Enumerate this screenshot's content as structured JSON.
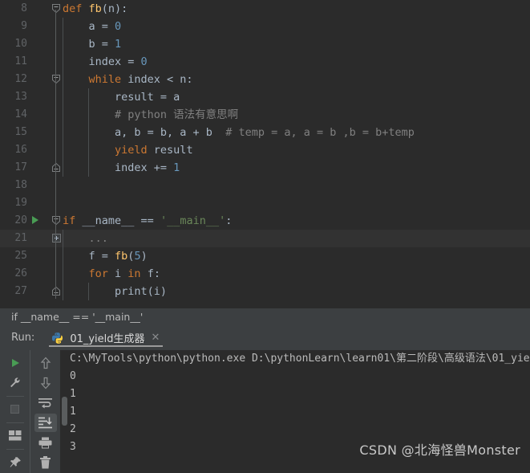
{
  "editor": {
    "lines": [
      {
        "num": "8",
        "indent": 0,
        "fold": "open",
        "run": false,
        "tokens": [
          {
            "t": "def ",
            "c": "kw"
          },
          {
            "t": "fb",
            "c": "fn"
          },
          {
            "t": "(n):",
            "c": "def"
          }
        ]
      },
      {
        "num": "9",
        "indent": 1,
        "fold": "none",
        "run": false,
        "tokens": [
          {
            "t": "    a = ",
            "c": "def"
          },
          {
            "t": "0",
            "c": "num"
          }
        ]
      },
      {
        "num": "10",
        "indent": 1,
        "fold": "none",
        "run": false,
        "tokens": [
          {
            "t": "    b = ",
            "c": "def"
          },
          {
            "t": "1",
            "c": "num"
          }
        ]
      },
      {
        "num": "11",
        "indent": 1,
        "fold": "none",
        "run": false,
        "tokens": [
          {
            "t": "    index = ",
            "c": "def"
          },
          {
            "t": "0",
            "c": "num"
          }
        ]
      },
      {
        "num": "12",
        "indent": 1,
        "fold": "open2",
        "run": false,
        "tokens": [
          {
            "t": "    ",
            "c": "def"
          },
          {
            "t": "while",
            "c": "kw"
          },
          {
            "t": " index < n:",
            "c": "def"
          }
        ]
      },
      {
        "num": "13",
        "indent": 2,
        "fold": "none",
        "run": false,
        "tokens": [
          {
            "t": "        result = a",
            "c": "def"
          }
        ]
      },
      {
        "num": "14",
        "indent": 2,
        "fold": "none",
        "run": false,
        "tokens": [
          {
            "t": "        # python 语法有意思啊",
            "c": "com"
          }
        ]
      },
      {
        "num": "15",
        "indent": 2,
        "fold": "none",
        "run": false,
        "tokens": [
          {
            "t": "        a, b = b, a + b  ",
            "c": "def"
          },
          {
            "t": "# temp = a, a = b ,b = b+temp",
            "c": "com"
          }
        ]
      },
      {
        "num": "16",
        "indent": 2,
        "fold": "none",
        "run": false,
        "tokens": [
          {
            "t": "        ",
            "c": "def"
          },
          {
            "t": "yield",
            "c": "kw"
          },
          {
            "t": " result",
            "c": "def"
          }
        ]
      },
      {
        "num": "17",
        "indent": 2,
        "fold": "close2",
        "run": false,
        "tokens": [
          {
            "t": "        index += ",
            "c": "def"
          },
          {
            "t": "1",
            "c": "num"
          }
        ]
      },
      {
        "num": "18",
        "indent": 0,
        "fold": "none",
        "run": false,
        "tokens": []
      },
      {
        "num": "19",
        "indent": 0,
        "fold": "none",
        "run": false,
        "tokens": []
      },
      {
        "num": "20",
        "indent": 0,
        "fold": "open",
        "run": true,
        "tokens": [
          {
            "t": "if",
            "c": "kw"
          },
          {
            "t": " __name__ == ",
            "c": "def"
          },
          {
            "t": "'__main__'",
            "c": "str"
          },
          {
            "t": ":",
            "c": "def"
          }
        ]
      },
      {
        "num": "21",
        "indent": 1,
        "fold": "plus",
        "run": false,
        "folded": true,
        "tokens": [
          {
            "t": "    ...",
            "c": "ph"
          }
        ]
      },
      {
        "num": "25",
        "indent": 1,
        "fold": "none",
        "run": false,
        "tokens": [
          {
            "t": "    f = ",
            "c": "def"
          },
          {
            "t": "fb",
            "c": "fn"
          },
          {
            "t": "(",
            "c": "def"
          },
          {
            "t": "5",
            "c": "num"
          },
          {
            "t": ")",
            "c": "def"
          }
        ]
      },
      {
        "num": "26",
        "indent": 1,
        "fold": "none",
        "run": false,
        "tokens": [
          {
            "t": "    ",
            "c": "def"
          },
          {
            "t": "for",
            "c": "kw"
          },
          {
            "t": " i ",
            "c": "def"
          },
          {
            "t": "in",
            "c": "kw"
          },
          {
            "t": " f:",
            "c": "def"
          }
        ]
      },
      {
        "num": "27",
        "indent": 2,
        "fold": "close2",
        "run": false,
        "tokens": [
          {
            "t": "        ",
            "c": "def"
          },
          {
            "t": "print",
            "c": "def"
          },
          {
            "t": "(i)",
            "c": "def"
          }
        ]
      }
    ]
  },
  "breadcrumb": {
    "text": "if __name__ == '__main__'"
  },
  "run_panel": {
    "label": "Run:",
    "tab_name": "01_yield生成器",
    "tab_close": "✕",
    "toolbar_left": [
      {
        "name": "rerun-button",
        "icon": "play-icon"
      },
      {
        "name": "debug-button",
        "icon": "wrench-icon"
      },
      {
        "name": "stop-button",
        "icon": "stop-icon"
      },
      {
        "name": "layout-button",
        "icon": "layout-icon"
      },
      {
        "name": "pin-button",
        "icon": "pin-icon"
      }
    ],
    "toolbar_right": [
      {
        "name": "up-button",
        "icon": "arrow-up-icon"
      },
      {
        "name": "down-button",
        "icon": "arrow-down-icon"
      },
      {
        "name": "soft-wrap-button",
        "icon": "soft-wrap-icon"
      },
      {
        "name": "scroll-end-button",
        "icon": "scroll-to-end-icon",
        "active": true
      },
      {
        "name": "print-button",
        "icon": "printer-icon"
      },
      {
        "name": "clear-all-button",
        "icon": "trash-icon"
      }
    ],
    "console": {
      "command": "C:\\MyTools\\python\\python.exe D:\\pythonLearn\\learn01\\第二阶段\\高级语法\\01_yie",
      "output": [
        "0",
        "1",
        "1",
        "2",
        "3"
      ]
    }
  },
  "watermark": {
    "text": "CSDN @北海怪兽Monster"
  },
  "colors": {
    "editor_bg": "#2b2b2b",
    "panel_bg": "#3c3f41",
    "keyword": "#cc7832",
    "number": "#6897bb",
    "string": "#6a8759",
    "comment": "#808080",
    "function": "#ffc66d",
    "text": "#a9b7c6",
    "line_number": "#606366",
    "run_green": "#499c54"
  }
}
